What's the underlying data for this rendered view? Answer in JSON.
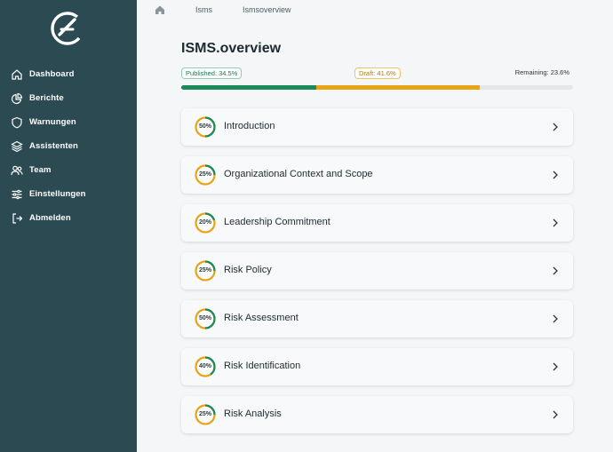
{
  "nav": {
    "items": [
      {
        "label": "Dashboard",
        "icon": "home-icon"
      },
      {
        "label": "Berichte",
        "icon": "chart-pie-icon"
      },
      {
        "label": "Warnungen",
        "icon": "shield-icon"
      },
      {
        "label": "Assistenten",
        "icon": "layers-icon"
      },
      {
        "label": "Team",
        "icon": "users-icon"
      },
      {
        "label": "Einstellungen",
        "icon": "sliders-icon"
      },
      {
        "label": "Abmelden",
        "icon": "logout-icon"
      }
    ]
  },
  "breadcrumb": {
    "items": [
      "Isms",
      "Ismsoverview"
    ]
  },
  "page": {
    "title": "ISMS.overview"
  },
  "progress": {
    "published_label": "Published: 34.5%",
    "draft_label": "Draft: 41.6%",
    "remaining_label": "Remaining: 23.6%",
    "published_pct": 34.5,
    "draft_pct": 41.6,
    "remaining_pct": 23.6
  },
  "sections": [
    {
      "title": "Introduction",
      "percent_label": "50%",
      "percent": 50
    },
    {
      "title": "Organizational Context and Scope",
      "percent_label": "25%",
      "percent": 25
    },
    {
      "title": "Leadership Commitment",
      "percent_label": "20%",
      "percent": 20
    },
    {
      "title": "Risk Policy",
      "percent_label": "25%",
      "percent": 25
    },
    {
      "title": "Risk Assessment",
      "percent_label": "50%",
      "percent": 50
    },
    {
      "title": "Risk Identification",
      "percent_label": "40%",
      "percent": 40
    },
    {
      "title": "Risk Analysis",
      "percent_label": "25%",
      "percent": 25
    }
  ],
  "colors": {
    "sidebar": "#2c4a52",
    "published": "#1a8a5a",
    "draft": "#e8a317",
    "remaining": "#e4e7e9"
  }
}
